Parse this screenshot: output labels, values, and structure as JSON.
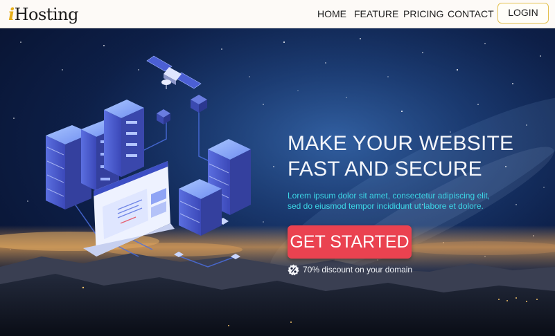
{
  "brand": {
    "logo_initial": "i",
    "logo_rest": "Hosting"
  },
  "nav": {
    "links": [
      "HOME",
      "FEATURE",
      "PRICING",
      "CONTACT"
    ],
    "login_label": "LOGIN"
  },
  "hero": {
    "headline_line1": "MAKE YOUR WEBSITE",
    "headline_line2": "FAST AND SECURE",
    "subtext_line1": "Lorem ipsum dolor sit amet, consectetur adipiscing elit,",
    "subtext_line2": "sed do eiusmod tempor incididunt ut labore et dolore.",
    "cta_label": "GET STARTED",
    "discount_text": "70% discount on your domain",
    "discount_icon": "percent-badge-icon",
    "illustration": "isometric-servers-satellite-illustration"
  },
  "colors": {
    "accent": "#ea4250",
    "logo_accent": "#e7ae17",
    "subtext": "#3cd6e6",
    "navbar_bg": "#fdfaf7",
    "login_border": "#e3c04d"
  }
}
